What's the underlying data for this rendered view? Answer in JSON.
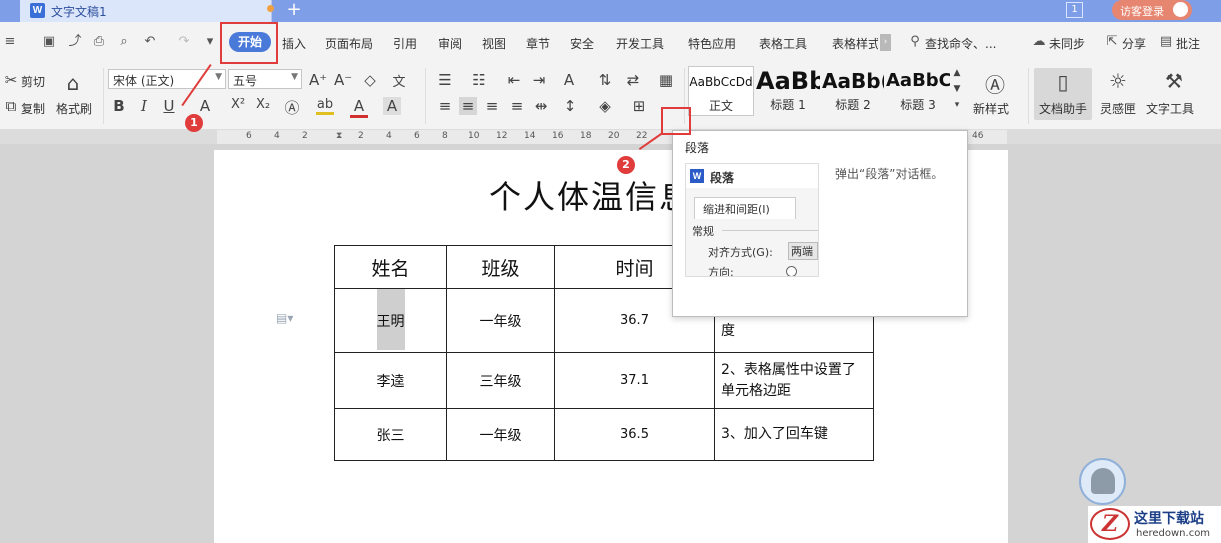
{
  "titlebar": {
    "doc_title": "文字文稿1",
    "new_tab": "+",
    "badge": "1",
    "login": "访客登录"
  },
  "menu": {
    "tabs": [
      "开始",
      "插入",
      "页面布局",
      "引用",
      "审阅",
      "视图",
      "章节",
      "安全",
      "开发工具",
      "特色应用",
      "表格工具",
      "表格样式"
    ],
    "search": "查找命令、...",
    "sync": "未同步",
    "share": "分享",
    "comment": "批注"
  },
  "ribbon": {
    "cut": "剪切",
    "copy": "复制",
    "format_painter": "格式刷",
    "font_name": "宋体 (正文)",
    "font_size": "五号",
    "bold": "B",
    "italic": "I",
    "underline": "U",
    "superscript": "X²",
    "subscript": "X₂",
    "styles": [
      {
        "sample": "AaBbCcDd",
        "name": "正文"
      },
      {
        "sample": "AaBb",
        "name": "标题 1"
      },
      {
        "sample": "AaBb(",
        "name": "标题 2"
      },
      {
        "sample": "AaBbC(",
        "name": "标题 3"
      }
    ],
    "new_style": "新样式",
    "doc_assistant": "文档助手",
    "inspiration": "灵感匣",
    "text_tools": "文字工具"
  },
  "ruler": {
    "numbers": [
      "6",
      "4",
      "2",
      "2",
      "4",
      "6",
      "8",
      "10",
      "12",
      "14",
      "16",
      "18",
      "20",
      "22",
      "46"
    ]
  },
  "document": {
    "title": "个人体温信息",
    "table": {
      "headers": [
        "姓名",
        "班级",
        "时间",
        ""
      ],
      "rows": [
        [
          "王明",
          "一年级",
          "36.7",
          "1、段落前后设置了高度"
        ],
        [
          "李逵",
          "三年级",
          "37.1",
          "2、表格属性中设置了单元格边距"
        ],
        [
          "张三",
          "一年级",
          "36.5",
          "3、加入了回车键"
        ]
      ]
    }
  },
  "tooltip": {
    "title": "段落",
    "description": "弹出“段落”对话框。",
    "dialog_title": "段落",
    "dialog_tab": "缩进和间距(I)",
    "group": "常规",
    "align_label": "对齐方式(G):",
    "align_value": "两端",
    "direction_label": "方向:"
  },
  "annotations": [
    "1",
    "2"
  ],
  "watermark": {
    "title": "这里下载站",
    "url": "heredown.com"
  },
  "colors": {
    "accent": "#4a7ad9",
    "title_bar": "#7f9ee8",
    "annotation_red": "#e03c3c"
  }
}
